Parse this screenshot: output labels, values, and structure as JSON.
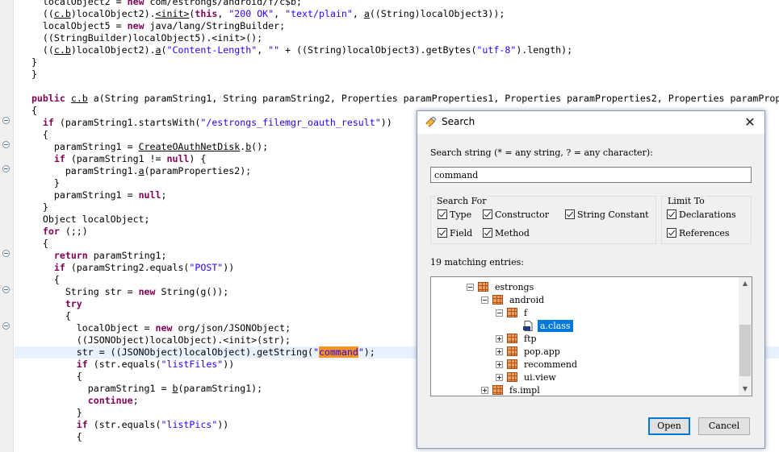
{
  "editor": {
    "lines": [
      {
        "html": "  localObject2 = <span class=\"kw\">new</span> com/estrongs/android/f/c$b;"
      },
      {
        "html": "  ((<span class=\"u\">c.b</span>)localObject2).<span class=\"u\">&lt;init&gt;</span>(<span class=\"kw\">this</span>, <span class=\"str\">\"200 OK\"</span>, <span class=\"str\">\"text/plain\"</span>, <span class=\"u\">a</span>((String)localObject3));"
      },
      {
        "html": "  localObject5 = <span class=\"kw\">new</span> java/lang/StringBuilder;"
      },
      {
        "html": "  ((StringBuilder)localObject5).&lt;init&gt;();"
      },
      {
        "html": "  ((<span class=\"u\">c.b</span>)localObject2).<span class=\"u\">a</span>(<span class=\"str\">\"Content-Length\"</span>, <span class=\"str\">\"\"</span> + ((String)localObject3).getBytes(<span class=\"str\">\"utf-8\"</span>).length);"
      },
      {
        "html": "}"
      },
      {
        "html": "}"
      },
      {
        "html": ""
      },
      {
        "html": "<span class=\"kw\">public</span> <span class=\"u\">c.b</span> a(String paramString1, String paramString2, Properties paramProperties1, Properties paramProperties2, Properties paramPrope"
      },
      {
        "html": "{"
      },
      {
        "html": "  <span class=\"kw\">if</span> (paramString1.startsWith(<span class=\"str\">\"/estrongs_filemgr_oauth_result\"</span>))"
      },
      {
        "html": "  {"
      },
      {
        "html": "    paramString1 = <span class=\"u\">CreateOAuthNetDisk</span>.<span class=\"u\">b</span>();"
      },
      {
        "html": "    <span class=\"kw\">if</span> (paramString1 != <span class=\"kw\">null</span>) {"
      },
      {
        "html": "      paramString1.<span class=\"u\">a</span>(paramProperties2);"
      },
      {
        "html": "    }"
      },
      {
        "html": "    paramString1 = <span class=\"kw\">null</span>;"
      },
      {
        "html": "  }"
      },
      {
        "html": "  Object localObject;"
      },
      {
        "html": "  <span class=\"kw\">for</span> (;;)"
      },
      {
        "html": "  {"
      },
      {
        "html": "    <span class=\"kw\">return</span> paramString1;"
      },
      {
        "html": "    <span class=\"kw\">if</span> (paramString2.equals(<span class=\"str\">\"POST\"</span>))"
      },
      {
        "html": "    {"
      },
      {
        "html": "      String str = <span class=\"kw\">new</span> String(<span class=\"u\">g</span>());"
      },
      {
        "html": "      <span class=\"kw\">try</span>"
      },
      {
        "html": "      {"
      },
      {
        "html": "        localObject = <span class=\"kw\">new</span> org/json/JSONObject;"
      },
      {
        "html": "        ((JSONObject)localObject).&lt;init&gt;(str);"
      },
      {
        "html": "        str = ((JSONObject)localObject).getString(<span class=\"str\">\"</span><span class=\"match\">command</span><span class=\"str\">\"</span>);",
        "highlight": true
      },
      {
        "html": "        <span class=\"kw\">if</span> (str.equals(<span class=\"str\">\"listFiles\"</span>))"
      },
      {
        "html": "        {"
      },
      {
        "html": "          paramString1 = <span class=\"u\">b</span>(paramString1);"
      },
      {
        "html": "          <span class=\"kw\">continue</span>;"
      },
      {
        "html": "        }"
      },
      {
        "html": "        <span class=\"kw\">if</span> (str.equals(<span class=\"str\">\"listPics\"</span>))"
      },
      {
        "html": "        {"
      }
    ]
  },
  "dialog": {
    "title": "Search",
    "close_label": "✕",
    "search_string_label": "Search string (* = any string, ? = any character):",
    "search_value": "command",
    "search_for": {
      "title": "Search For",
      "options": [
        {
          "label": "Type",
          "checked": true
        },
        {
          "label": "Constructor",
          "checked": true
        },
        {
          "label": "String Constant",
          "checked": true
        },
        {
          "label": "Field",
          "checked": true
        },
        {
          "label": "Method",
          "checked": true
        }
      ]
    },
    "limit_to": {
      "title": "Limit To",
      "options": [
        {
          "label": "Declarations",
          "checked": true
        },
        {
          "label": "References",
          "checked": true
        }
      ]
    },
    "matches_label": "19 matching entries:",
    "tree": [
      {
        "label": "estrongs",
        "expander": "minus"
      },
      {
        "label": "android",
        "expander": "minus"
      },
      {
        "label": "f",
        "expander": "minus"
      },
      {
        "label": "a.class",
        "expander": "none",
        "kind": "class",
        "selected": true
      },
      {
        "label": "ftp",
        "expander": "plus"
      },
      {
        "label": "pop.app",
        "expander": "plus"
      },
      {
        "label": "recommend",
        "expander": "plus"
      },
      {
        "label": "ui.view",
        "expander": "plus"
      },
      {
        "label": "fs.impl",
        "expander": "plus"
      }
    ],
    "open_label": "Open",
    "cancel_label": "Cancel",
    "colors": {
      "selection": "#0078d7",
      "match_highlight": "#f39422"
    }
  }
}
